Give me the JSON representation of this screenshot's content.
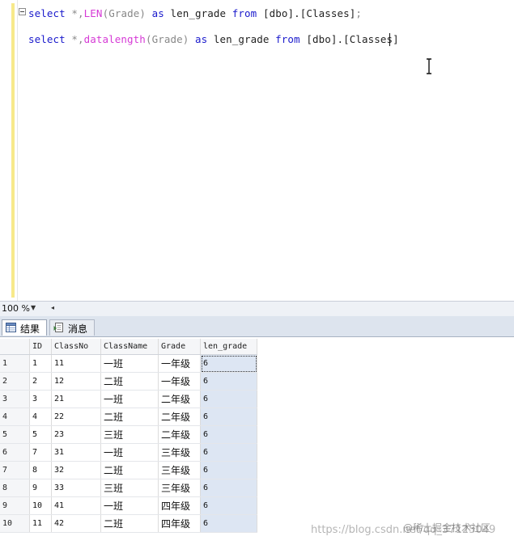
{
  "editor": {
    "line1": {
      "kw_select": "select",
      "star": "*,",
      "fn": "LEN",
      "arg": "(Grade)",
      "kw_as": "as",
      "alias": "len_grade",
      "kw_from": "from",
      "table": "[dbo].[Classes]",
      "end": ";"
    },
    "line2": {
      "kw_select": "select",
      "star": "*,",
      "fn": "datalength",
      "arg": "(Grade)",
      "kw_as": "as",
      "alias": "len_grade",
      "kw_from": "from",
      "table": "[dbo].[Classes]"
    }
  },
  "zoom": {
    "value": "100 %"
  },
  "tabs": {
    "results": "结果",
    "messages": "消息"
  },
  "grid": {
    "columns": [
      "ID",
      "ClassNo",
      "ClassName",
      "Grade",
      "len_grade"
    ],
    "rows": [
      {
        "n": "1",
        "id": "1",
        "no": "11",
        "name": "一班",
        "grade": "一年级",
        "len": "6"
      },
      {
        "n": "2",
        "id": "2",
        "no": "12",
        "name": "二班",
        "grade": "一年级",
        "len": "6"
      },
      {
        "n": "3",
        "id": "3",
        "no": "21",
        "name": "一班",
        "grade": "二年级",
        "len": "6"
      },
      {
        "n": "4",
        "id": "4",
        "no": "22",
        "name": "二班",
        "grade": "二年级",
        "len": "6"
      },
      {
        "n": "5",
        "id": "5",
        "no": "23",
        "name": "三班",
        "grade": "二年级",
        "len": "6"
      },
      {
        "n": "6",
        "id": "7",
        "no": "31",
        "name": "一班",
        "grade": "三年级",
        "len": "6"
      },
      {
        "n": "7",
        "id": "8",
        "no": "32",
        "name": "二班",
        "grade": "三年级",
        "len": "6"
      },
      {
        "n": "8",
        "id": "9",
        "no": "33",
        "name": "三班",
        "grade": "三年级",
        "len": "6"
      },
      {
        "n": "9",
        "id": "10",
        "no": "41",
        "name": "一班",
        "grade": "四年级",
        "len": "6"
      },
      {
        "n": "10",
        "id": "11",
        "no": "42",
        "name": "二班",
        "grade": "四年级",
        "len": "6"
      }
    ]
  },
  "watermark": {
    "url": "https://blog.csdn.net/qq_37125049",
    "brand": "@稀土掘金技术社区"
  }
}
